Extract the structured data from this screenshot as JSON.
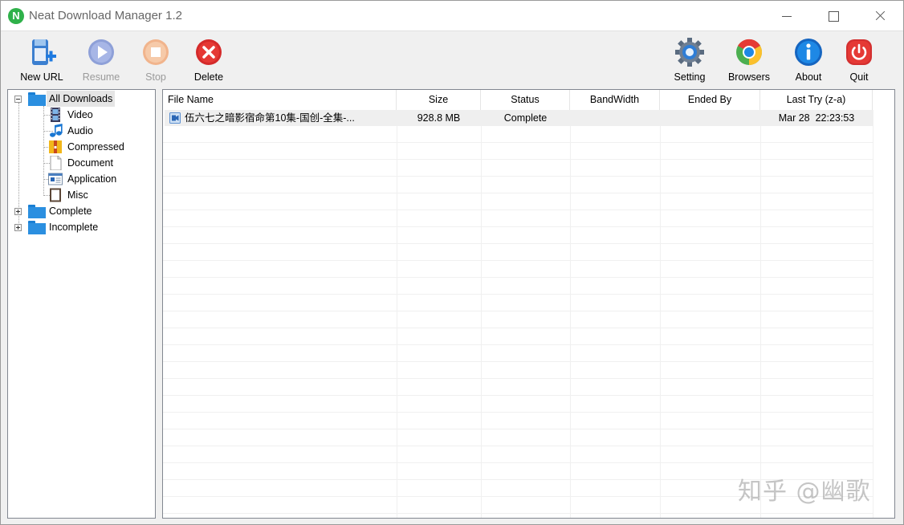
{
  "window": {
    "title": "Neat Download Manager 1.2",
    "logo_letter": "N"
  },
  "toolbar": {
    "new_url": "New URL",
    "resume": "Resume",
    "stop": "Stop",
    "delete": "Delete",
    "setting": "Setting",
    "browsers": "Browsers",
    "about": "About",
    "quit": "Quit"
  },
  "tree": {
    "root": "All Downloads",
    "categories": [
      "Video",
      "Audio",
      "Compressed",
      "Document",
      "Application",
      "Misc"
    ],
    "complete": "Complete",
    "incomplete": "Incomplete"
  },
  "list": {
    "columns": [
      "File Name",
      "Size",
      "Status",
      "BandWidth",
      "Ended By",
      "Last Try (z-a)"
    ],
    "rows": [
      {
        "file_name": "伍六七之暗影宿命第10集-国创-全集-...",
        "size": "928.8 MB",
        "status": "Complete",
        "bandwidth": "",
        "ended_by": "",
        "last_try": "Mar 28  22:23:53"
      }
    ]
  },
  "watermark": "知乎 @幽歌"
}
